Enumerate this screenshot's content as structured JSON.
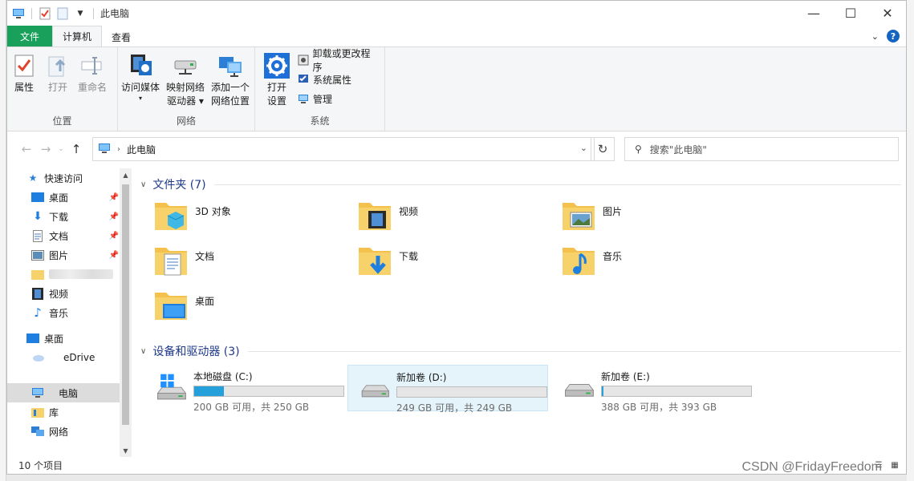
{
  "window": {
    "title": "此电脑",
    "controls": [
      "—",
      "☐",
      "✕"
    ]
  },
  "tabs": {
    "file": "文件",
    "computer": "计算机",
    "view": "查看"
  },
  "ribbon": {
    "location": {
      "label": "位置",
      "buttons": [
        {
          "label": "属性"
        },
        {
          "label": "打开"
        },
        {
          "label": "重命名"
        }
      ]
    },
    "network": {
      "label": "网络",
      "buttons": [
        {
          "label": "访问媒体",
          "label2": "▾"
        },
        {
          "label": "映射网络",
          "label2": "驱动器 ▾"
        },
        {
          "label": "添加一个",
          "label2": "网络位置"
        }
      ]
    },
    "system": {
      "label": "系统",
      "open_settings": {
        "label": "打开",
        "label2": "设置"
      },
      "small": [
        {
          "label": "卸载或更改程序"
        },
        {
          "label": "系统属性"
        },
        {
          "label": "管理"
        }
      ]
    }
  },
  "address": {
    "path": "此电脑",
    "search_placeholder": "搜索\"此电脑\""
  },
  "nav": {
    "quick_access": "快速访问",
    "items": [
      {
        "label": "桌面"
      },
      {
        "label": "下载"
      },
      {
        "label": "文档"
      },
      {
        "label": "图片"
      },
      {
        "label": ""
      },
      {
        "label": "视频"
      },
      {
        "label": "音乐"
      }
    ],
    "desktop": "桌面",
    "onedrive": "eDrive",
    "this_pc": "电脑",
    "library": "库",
    "network": "网络"
  },
  "folders_section": {
    "title": "文件夹 (7)"
  },
  "folders": [
    {
      "name": "3D 对象"
    },
    {
      "name": "视频"
    },
    {
      "name": "图片"
    },
    {
      "name": "文档"
    },
    {
      "name": "下载"
    },
    {
      "name": "音乐"
    },
    {
      "name": "桌面"
    }
  ],
  "drives_section": {
    "title": "设备和驱动器 (3)"
  },
  "drives": [
    {
      "name": "本地磁盘 (C:)",
      "size": "200 GB 可用，共 250 GB",
      "used_fraction": 0.2
    },
    {
      "name": "新加卷 (D:)",
      "size": "249 GB 可用，共 249 GB",
      "used_fraction": 0.0
    },
    {
      "name": "新加卷 (E:)",
      "size": "388 GB 可用，共 393 GB",
      "used_fraction": 0.013
    }
  ],
  "status": {
    "count": "10 个项目"
  },
  "watermark": "CSDN @FridayFreedom",
  "colors": {
    "file_tab": "#19a05a",
    "drive_fill": "#26a0da",
    "selection": "#e5f3fb"
  }
}
